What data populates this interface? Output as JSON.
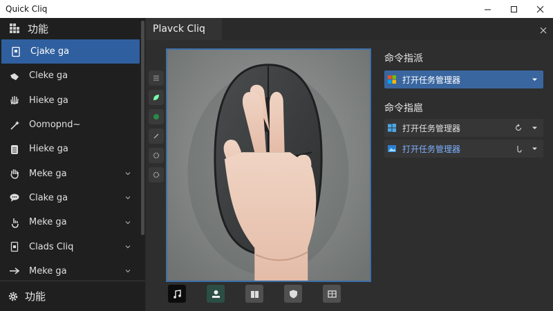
{
  "window": {
    "title": "Quick Cliq",
    "minimize_icon": "minimize-icon",
    "maximize_icon": "maximize-icon",
    "close_icon": "close-icon"
  },
  "sidebar": {
    "header": {
      "label": "功能",
      "icon": "grid-icon"
    },
    "items": [
      {
        "label": "Cjake ga",
        "icon": "document-icon",
        "active": true,
        "chevron": false
      },
      {
        "label": "Cleke ga",
        "icon": "pointer-hand-icon",
        "active": false,
        "chevron": false
      },
      {
        "label": "Hieke ga",
        "icon": "open-hand-icon",
        "active": false,
        "chevron": false
      },
      {
        "label": "Oomopnd~",
        "icon": "wand-icon",
        "active": false,
        "chevron": false
      },
      {
        "label": "Hieke ga",
        "icon": "clipboard-icon",
        "active": false,
        "chevron": false
      },
      {
        "label": "Meke ga",
        "icon": "hand-icon",
        "active": false,
        "chevron": true
      },
      {
        "label": "Clake ga",
        "icon": "chat-icon",
        "active": false,
        "chevron": true
      },
      {
        "label": "Meke ga",
        "icon": "tap-hand-icon",
        "active": false,
        "chevron": true
      },
      {
        "label": "Clads Cliq",
        "icon": "card-icon",
        "active": false,
        "chevron": true
      },
      {
        "label": "Meke ga",
        "icon": "arrow-right-icon",
        "active": false,
        "chevron": true
      }
    ],
    "footer": {
      "label": "功能",
      "icon": "gear-icon"
    }
  },
  "main": {
    "tab_label": "Plavck Cliq",
    "close_icon": "close-icon",
    "preview_image": "hand-on-mouse-image",
    "bottom_icons": [
      "music-icon",
      "user-icon",
      "book-icon",
      "shield-icon",
      "panel-icon"
    ]
  },
  "panel": {
    "section1": {
      "title": "命令指派",
      "combo": {
        "value": "打开任务管理器",
        "icon": "windows-flag-icon"
      }
    },
    "section2": {
      "title": "命令指扈",
      "combos": [
        {
          "value": "打开任务管理器",
          "icon": "windows-logo-icon"
        },
        {
          "value": "打开任务管理器",
          "icon": "image-icon"
        }
      ]
    }
  },
  "colors": {
    "accent": "#2f5f9e",
    "sidebar_bg": "#1f1f1f",
    "main_bg": "#2e2e2e",
    "link": "#7fb0ff"
  }
}
